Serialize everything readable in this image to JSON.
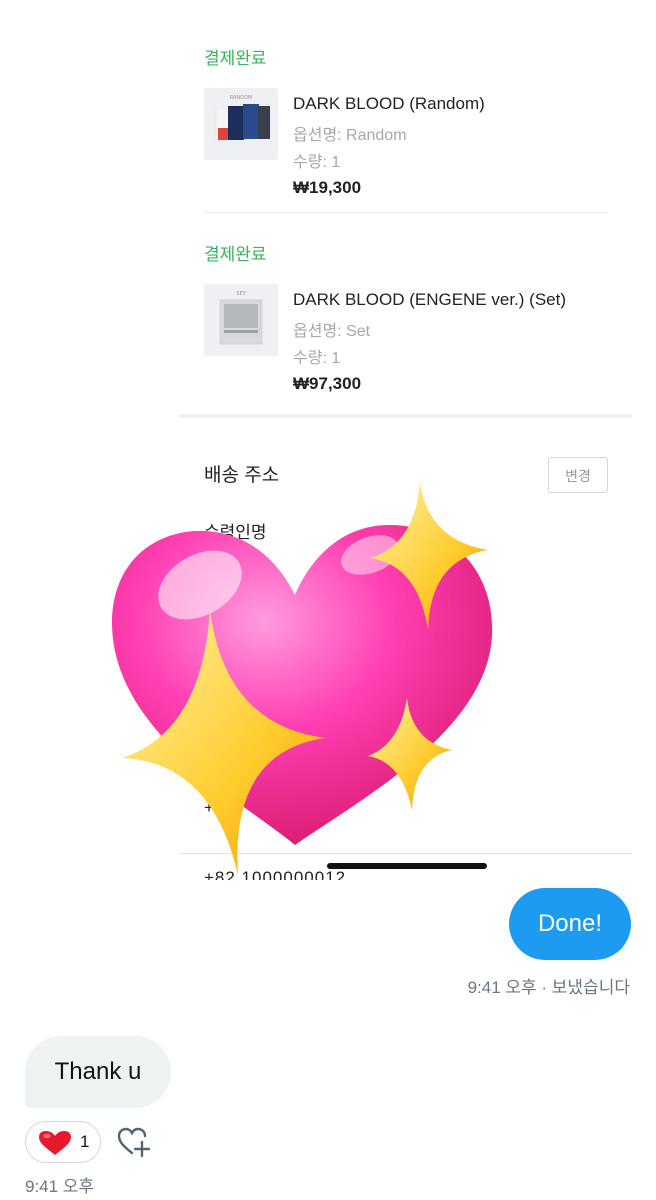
{
  "orders": [
    {
      "status": "결제완료",
      "thumb_text": "RANDOM",
      "name": "DARK BLOOD (Random)",
      "option": "옵션명: Random",
      "quantity": "수량: 1",
      "price": "₩19,300"
    },
    {
      "status": "결제완료",
      "thumb_text": "SET",
      "name": "DARK BLOOD (ENGENE ver.) (Set)",
      "option": "옵션명: Set",
      "quantity": "수량: 1",
      "price": "₩97,300"
    }
  ],
  "shipping": {
    "title": "배송 주소",
    "change_label": "변경",
    "recipient_label": "수령인명",
    "phone_partial": "+8",
    "phone_cut": "+82 1000000012"
  },
  "sticker": {
    "icon": "sparkling-heart-emoji",
    "heart_color": "#ff3fa4",
    "sparkle_color": "#ffcc33"
  },
  "chat": {
    "outgoing_text": "Done!",
    "outgoing_meta": "9:41 오후 · 보냈습니다",
    "incoming_text": "Thank u",
    "reaction_icon": "red-heart-icon",
    "reaction_count": "1",
    "add_reaction_icon": "add-reaction-icon",
    "incoming_meta": "9:41 오후",
    "accent": "#1d9bf0"
  }
}
